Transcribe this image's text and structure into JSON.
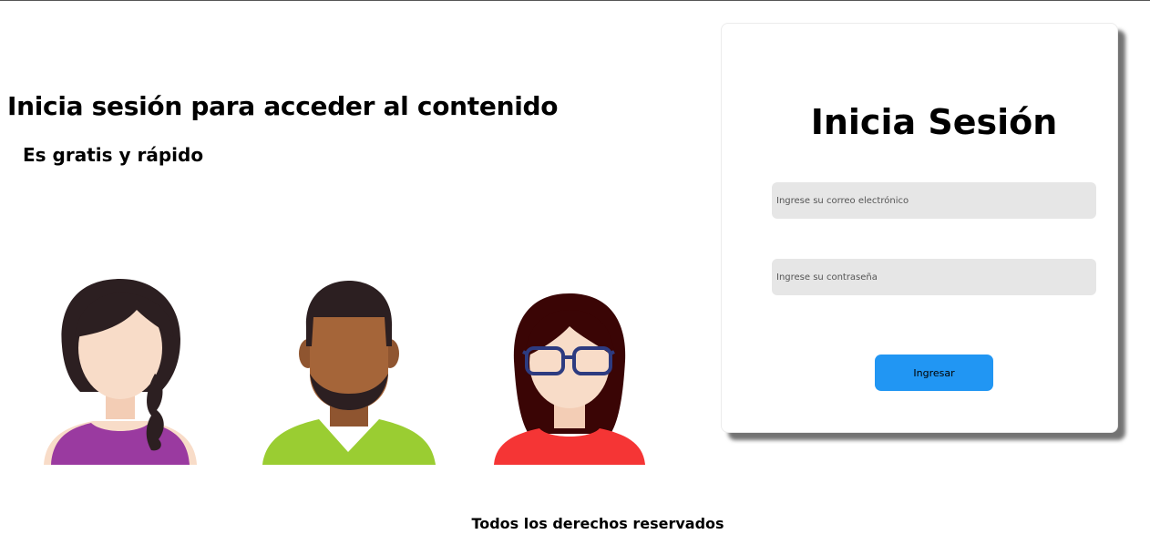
{
  "hero": {
    "title": "Inicia sesión para acceder al contenido",
    "subtitle": "Es gratis y rápido"
  },
  "avatars": [
    {
      "name": "woman-braid-avatar",
      "hair": "#2c1f21",
      "skin": "#f8dcc8",
      "shirt": "#9a3aa0"
    },
    {
      "name": "man-beard-avatar",
      "hair": "#2c1f21",
      "skin": "#a56539",
      "shirt": "#9acd32"
    },
    {
      "name": "woman-glasses-avatar",
      "hair": "#3a0505",
      "skin": "#f8dcc8",
      "shirt": "#f53535",
      "glasses": "#2d3b80"
    }
  ],
  "login": {
    "title": "Inicia Sesión",
    "email_placeholder": "Ingrese su correo electrónico",
    "password_placeholder": "Ingrese su contraseña",
    "submit_label": "Ingresar"
  },
  "footer": {
    "text": "Todos los derechos reservados"
  },
  "colors": {
    "button": "#2196f3",
    "input_bg": "#e6e6e6"
  }
}
